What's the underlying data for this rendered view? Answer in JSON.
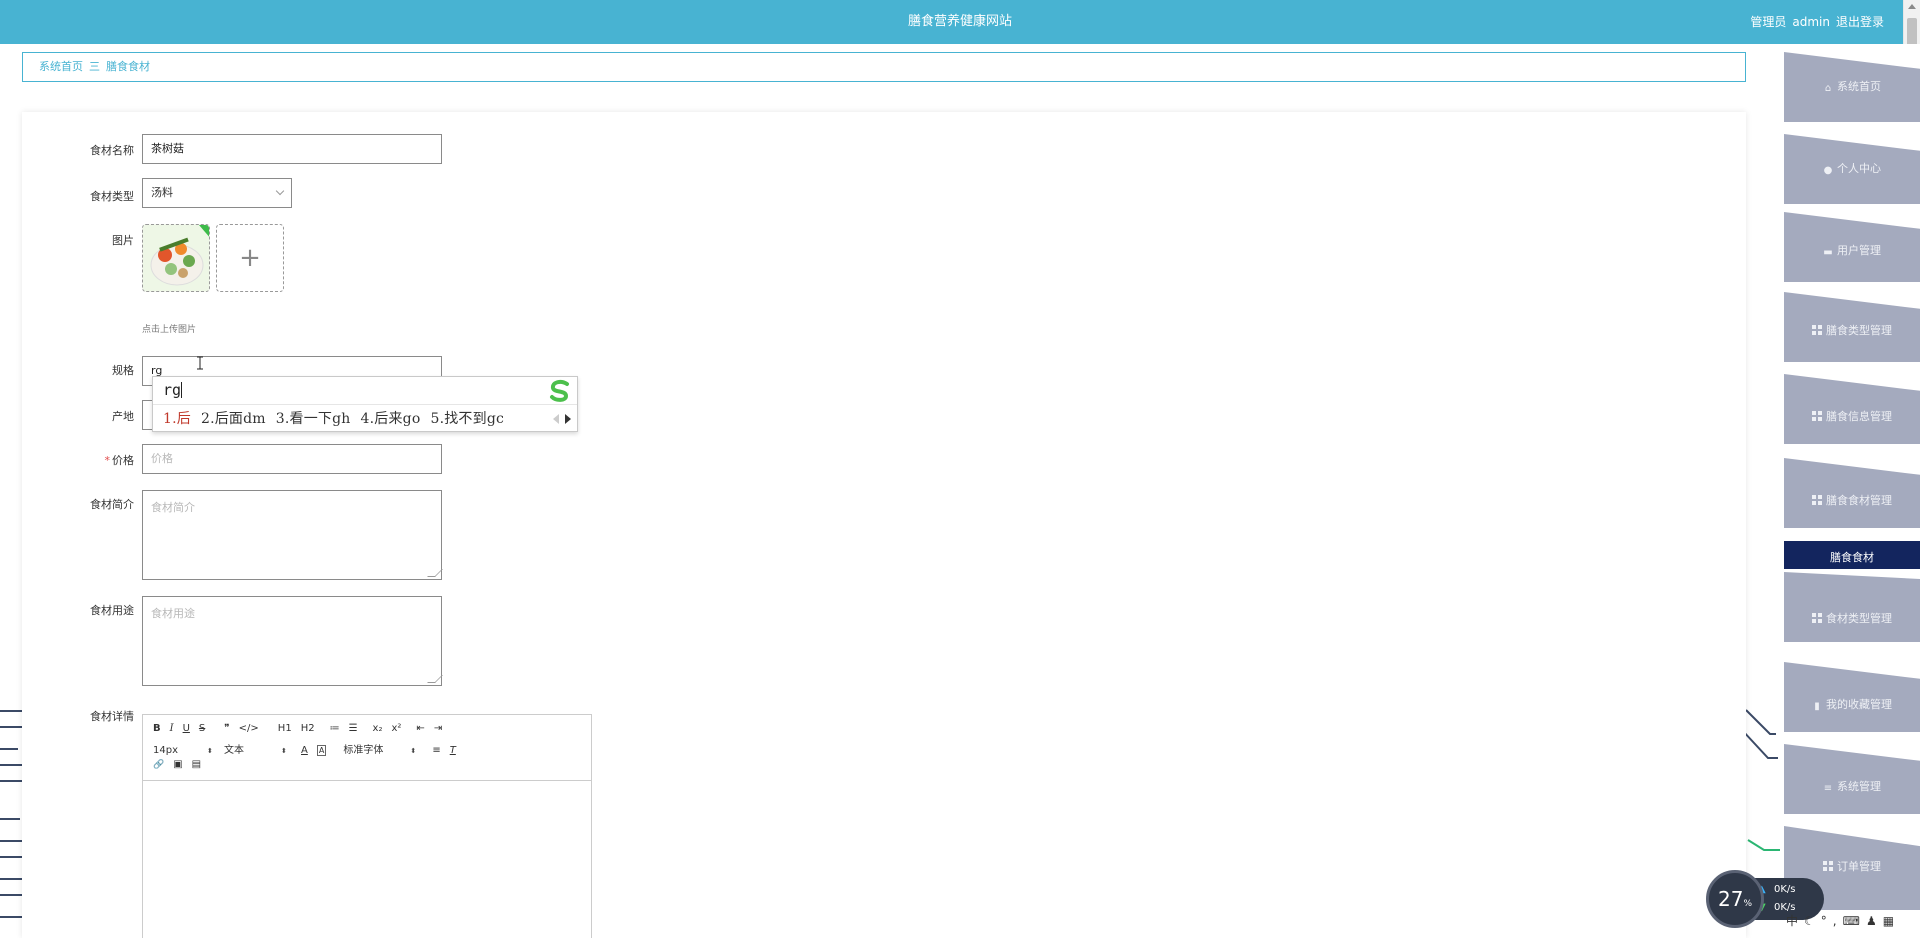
{
  "header": {
    "site_title": "膳食营养健康网站",
    "user_role": "管理员",
    "username": "admin",
    "logout": "退出登录"
  },
  "breadcrumb": {
    "home": "系统首页",
    "separator": "三",
    "current": "膳食食材"
  },
  "form": {
    "name": {
      "label": "食材名称",
      "value": "茶树菇"
    },
    "type": {
      "label": "食材类型",
      "value": "汤料"
    },
    "image": {
      "label": "图片",
      "hint": "点击上传图片",
      "add_symbol": "+"
    },
    "spec": {
      "label": "规格",
      "value": "rg"
    },
    "origin": {
      "label": "产地",
      "value": ""
    },
    "price": {
      "label": "价格",
      "required_mark": "*",
      "placeholder": "价格"
    },
    "intro": {
      "label": "食材简介",
      "placeholder": "食材简介"
    },
    "usage": {
      "label": "食材用途",
      "placeholder": "食材用途"
    },
    "detail": {
      "label": "食材详情"
    }
  },
  "ime": {
    "typed": "rg",
    "candidates": [
      "1.后",
      "2.后面dm",
      "3.看一下gh",
      "4.后来go",
      "5.找不到gc"
    ]
  },
  "editor": {
    "row1": [
      "B",
      "I",
      "U",
      "S",
      "❞",
      "</>",
      "H1",
      "H2",
      "≔",
      "☰",
      "x₂",
      "x²",
      "⇤",
      "⇥"
    ],
    "font_size": "14px",
    "block": "文本",
    "font_family": "标准字体",
    "row3": [
      "🔗",
      "▣",
      "▤"
    ]
  },
  "sidebar": {
    "items": [
      {
        "label": "系统首页",
        "icon": "home-icon"
      },
      {
        "label": "个人中心",
        "icon": "person-icon"
      },
      {
        "label": "用户管理",
        "icon": "briefcase-icon"
      },
      {
        "label": "膳食类型管理",
        "icon": "grid-icon"
      },
      {
        "label": "膳食信息管理",
        "icon": "grid-icon"
      },
      {
        "label": "膳食食材管理",
        "icon": "grid-icon"
      },
      {
        "label": "膳食食材",
        "icon": "",
        "active": true
      },
      {
        "label": "食材类型管理",
        "icon": "grid-icon"
      },
      {
        "label": "我的收藏管理",
        "icon": "clipboard-icon"
      },
      {
        "label": "系统管理",
        "icon": "list-icon"
      },
      {
        "label": "订单管理",
        "icon": "grid-icon"
      }
    ]
  },
  "netwidget": {
    "percent": "27",
    "percent_unit": "%",
    "up_speed": "0K/s",
    "down_speed": "0K/s"
  },
  "colors": {
    "header": "#48b3d2",
    "sidebar_item": "#a4aabe",
    "sidebar_active": "#13255e"
  }
}
